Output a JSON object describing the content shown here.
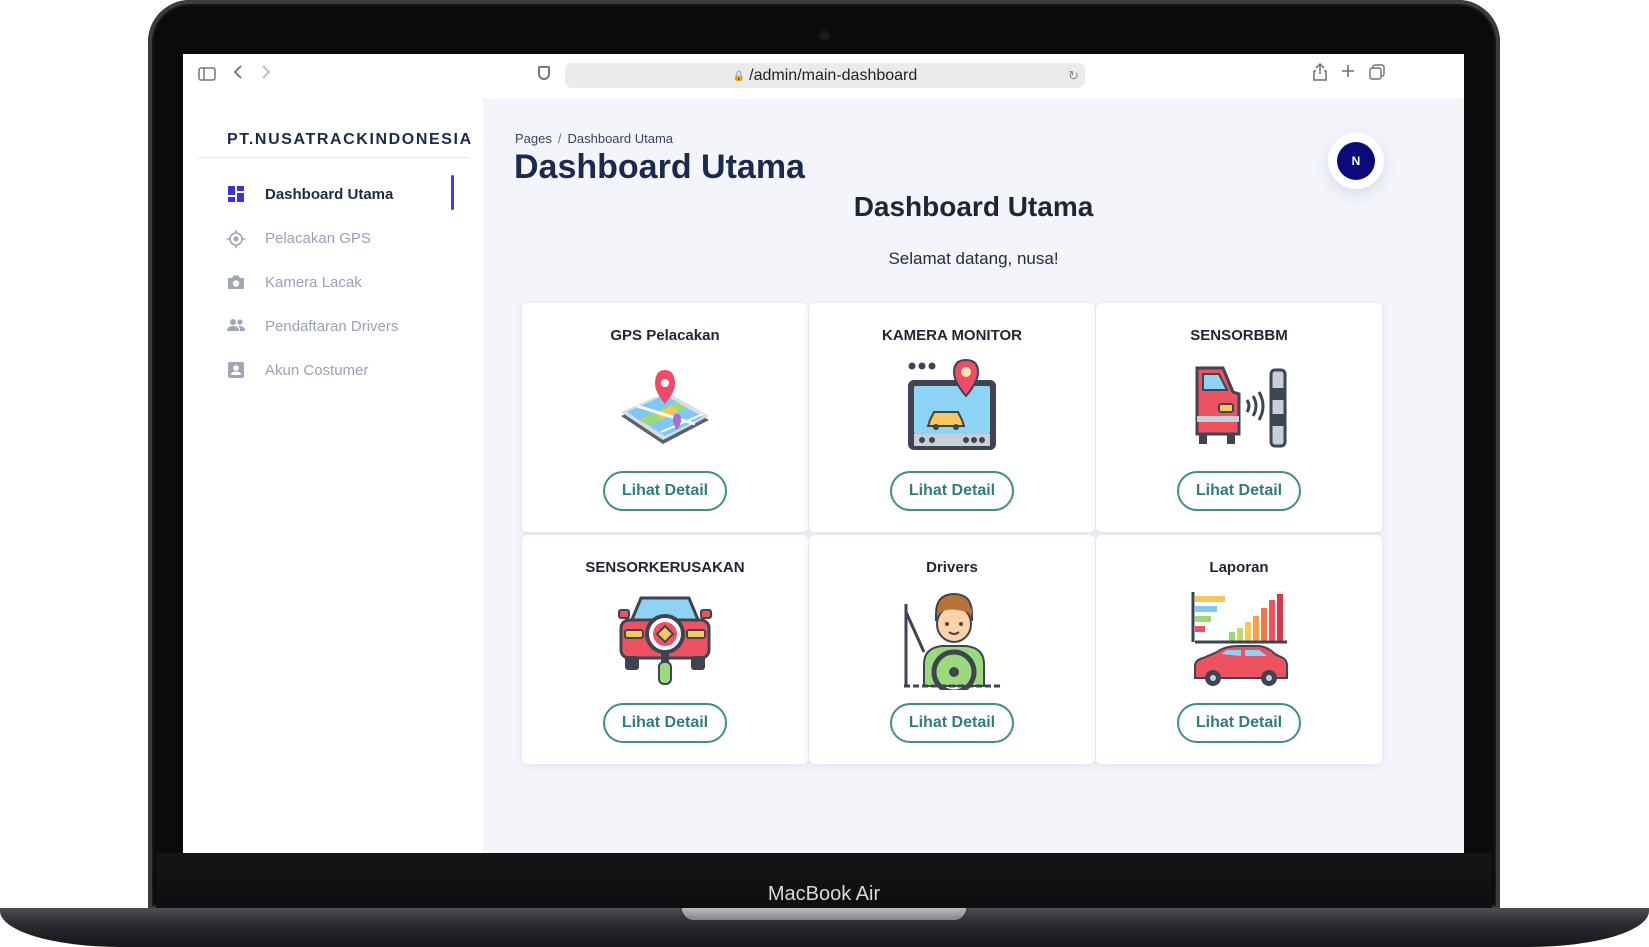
{
  "device": {
    "label": "MacBook Air"
  },
  "browser": {
    "url": "/admin/main-dashboard"
  },
  "sidebar": {
    "brand": "PT.NUSATRACKINDONESIA",
    "items": [
      {
        "label": "Dashboard Utama",
        "icon": "dashboard-icon",
        "active": true
      },
      {
        "label": "Pelacakan GPS",
        "icon": "gps-target-icon",
        "active": false
      },
      {
        "label": "Kamera Lacak",
        "icon": "camera-icon",
        "active": false
      },
      {
        "label": "Pendaftaran Drivers",
        "icon": "users-icon",
        "active": false
      },
      {
        "label": "Akun Costumer",
        "icon": "account-icon",
        "active": false
      }
    ]
  },
  "header": {
    "breadcrumb_root": "Pages",
    "breadcrumb_sep": "/",
    "breadcrumb_current": "Dashboard Utama",
    "title": "Dashboard Utama",
    "avatar_initial": "N"
  },
  "main": {
    "section_title": "Dashboard Utama",
    "welcome": "Selamat datang, nusa!",
    "cards": [
      {
        "title": "GPS Pelacakan",
        "icon": "map-pin-icon",
        "button": "Lihat Detail"
      },
      {
        "title": "KAMERA MONITOR",
        "icon": "monitor-camera-icon",
        "button": "Lihat Detail"
      },
      {
        "title": "SENSORBBM",
        "icon": "car-sensor-icon",
        "button": "Lihat Detail"
      },
      {
        "title": "SENSORKERUSAKAN",
        "icon": "car-inspection-icon",
        "button": "Lihat Detail"
      },
      {
        "title": "Drivers",
        "icon": "driver-icon",
        "button": "Lihat Detail"
      },
      {
        "title": "Laporan",
        "icon": "report-chart-icon",
        "button": "Lihat Detail"
      }
    ]
  },
  "colors": {
    "accent": "#4b3be0",
    "button": "#3e8f87",
    "title": "#1d2a4f",
    "avatar": "#0b0a7a",
    "background": "#f3f5fb"
  }
}
